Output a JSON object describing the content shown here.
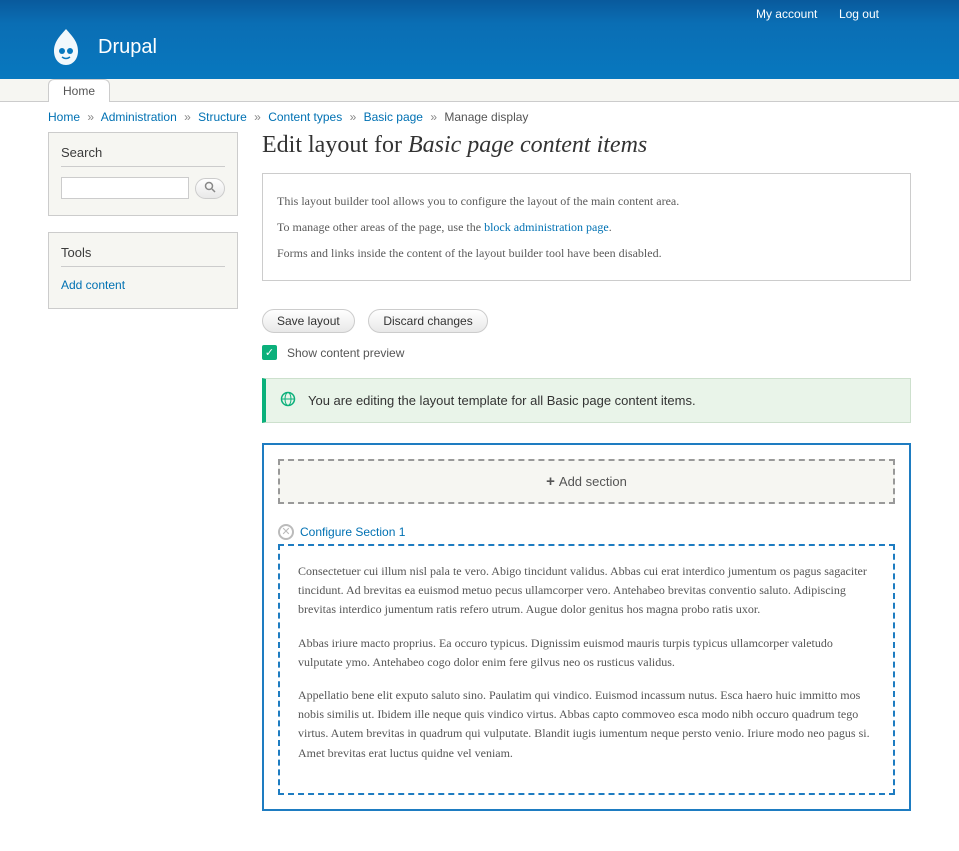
{
  "header": {
    "account_links": [
      "My account",
      "Log out"
    ],
    "site_name": "Drupal"
  },
  "nav": {
    "home": "Home"
  },
  "breadcrumb": {
    "items": [
      "Home",
      "Administration",
      "Structure",
      "Content types",
      "Basic page"
    ],
    "current": "Manage display"
  },
  "sidebar": {
    "search": {
      "title": "Search",
      "placeholder": ""
    },
    "tools": {
      "title": "Tools",
      "add_content": "Add content"
    }
  },
  "page": {
    "title_prefix": "Edit layout for ",
    "title_italic": "Basic page content items",
    "info": {
      "p1": "This layout builder tool allows you to configure the layout of the main content area.",
      "p2a": "To manage other areas of the page, use the ",
      "p2link": "block administration page",
      "p2b": ".",
      "p3": "Forms and links inside the content of the layout builder tool have been disabled."
    },
    "buttons": {
      "save": "Save layout",
      "discard": "Discard changes"
    },
    "checkbox_label": "Show content preview",
    "banner": "You are editing the layout template for all Basic page content items.",
    "add_section": "Add section",
    "configure_section": "Configure Section 1",
    "body": {
      "p1": "Consectetuer cui illum nisl pala te vero. Abigo tincidunt validus. Abbas cui erat interdico jumentum os pagus sagaciter tincidunt. Ad brevitas ea euismod metuo pecus ullamcorper vero. Antehabeo brevitas conventio saluto. Adipiscing brevitas interdico jumentum ratis refero utrum. Augue dolor genitus hos magna probo ratis uxor.",
      "p2": "Abbas iriure macto proprius. Ea occuro typicus. Dignissim euismod mauris turpis typicus ullamcorper valetudo vulputate ymo. Antehabeo cogo dolor enim fere gilvus neo os rusticus validus.",
      "p3": "Appellatio bene elit exputo saluto sino. Paulatim qui vindico. Euismod incassum nutus. Esca haero huic immitto mos nobis similis ut. Ibidem ille neque quis vindico virtus. Abbas capto commoveo esca modo nibh occuro quadrum tego virtus. Autem brevitas in quadrum qui vulputate. Blandit iugis iumentum neque persto venio. Iriure modo neo pagus si. Amet brevitas erat luctus quidne vel veniam."
    }
  }
}
